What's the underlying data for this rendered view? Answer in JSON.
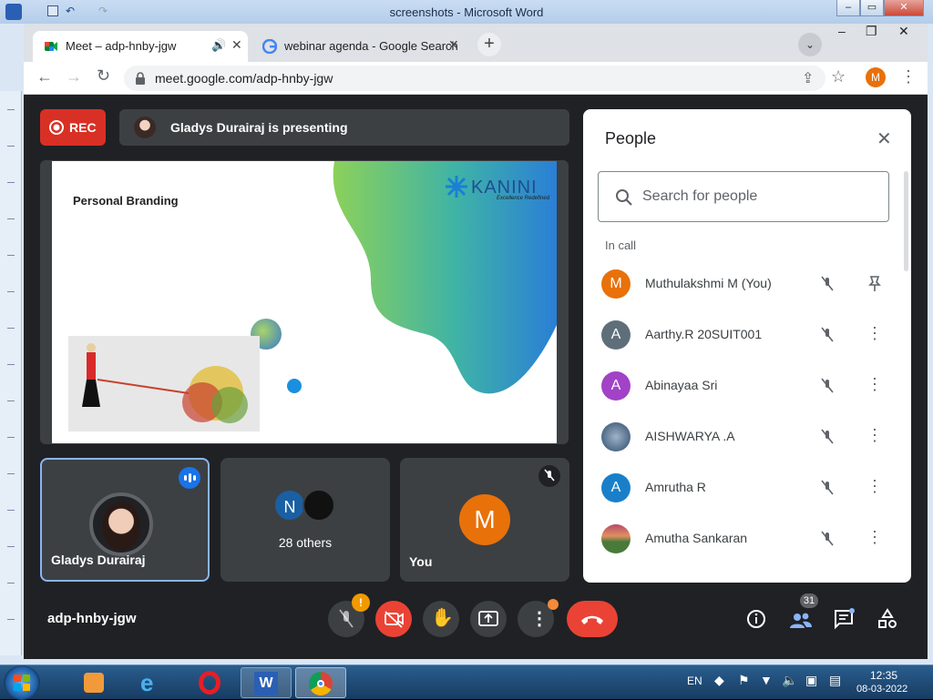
{
  "word": {
    "title": "screenshots - Microsoft Word",
    "min_label": "–",
    "max_label": "▭",
    "close_label": "✕"
  },
  "chrome": {
    "tab1": {
      "title": "Meet – adp-hnby-jgw"
    },
    "tab2": {
      "title": "webinar agenda - Google Search"
    },
    "url": "meet.google.com/adp-hnby-jgw",
    "profile_initial": "M"
  },
  "meet": {
    "rec_label": "REC",
    "presenting_text": "Gladys Durairaj is presenting",
    "slide": {
      "title": "Personal Branding",
      "brand": "KANINI",
      "brand_tagline": "Excellence Redefined"
    },
    "tiles": [
      {
        "name": "Gladys Durairaj"
      },
      {
        "name": "28 others",
        "initial": "N"
      },
      {
        "name": "You",
        "initial": "M"
      }
    ],
    "meeting_code": "adp-hnby-jgw",
    "participant_count": "31",
    "mic_alert": "!"
  },
  "people": {
    "title": "People",
    "search_placeholder": "Search for people",
    "section": "In call",
    "list": [
      {
        "name": "Muthulakshmi M (You)",
        "initial": "M",
        "color": "#e8710a"
      },
      {
        "name": "Aarthy.R 20SUIT001",
        "initial": "A",
        "color": "#5f6f7a"
      },
      {
        "name": "Abinayaa Sri",
        "initial": "A",
        "color": "#a142c7"
      },
      {
        "name": "AISHWARYA .A",
        "initial": "",
        "color": "#4a6a8a"
      },
      {
        "name": "Amrutha R",
        "initial": "A",
        "color": "#1a7fc9"
      },
      {
        "name": "Amutha Sankaran",
        "initial": "",
        "color": "#8a6a4a"
      }
    ]
  },
  "taskbar": {
    "lang": "EN",
    "time": "12:35",
    "date": "08-03-2022"
  },
  "colors": {
    "meet_bg": "#202124",
    "tile_bg": "#3c4043",
    "rec_red": "#d93025",
    "accent_blue": "#8ab4f8",
    "you_orange": "#e8710a"
  }
}
